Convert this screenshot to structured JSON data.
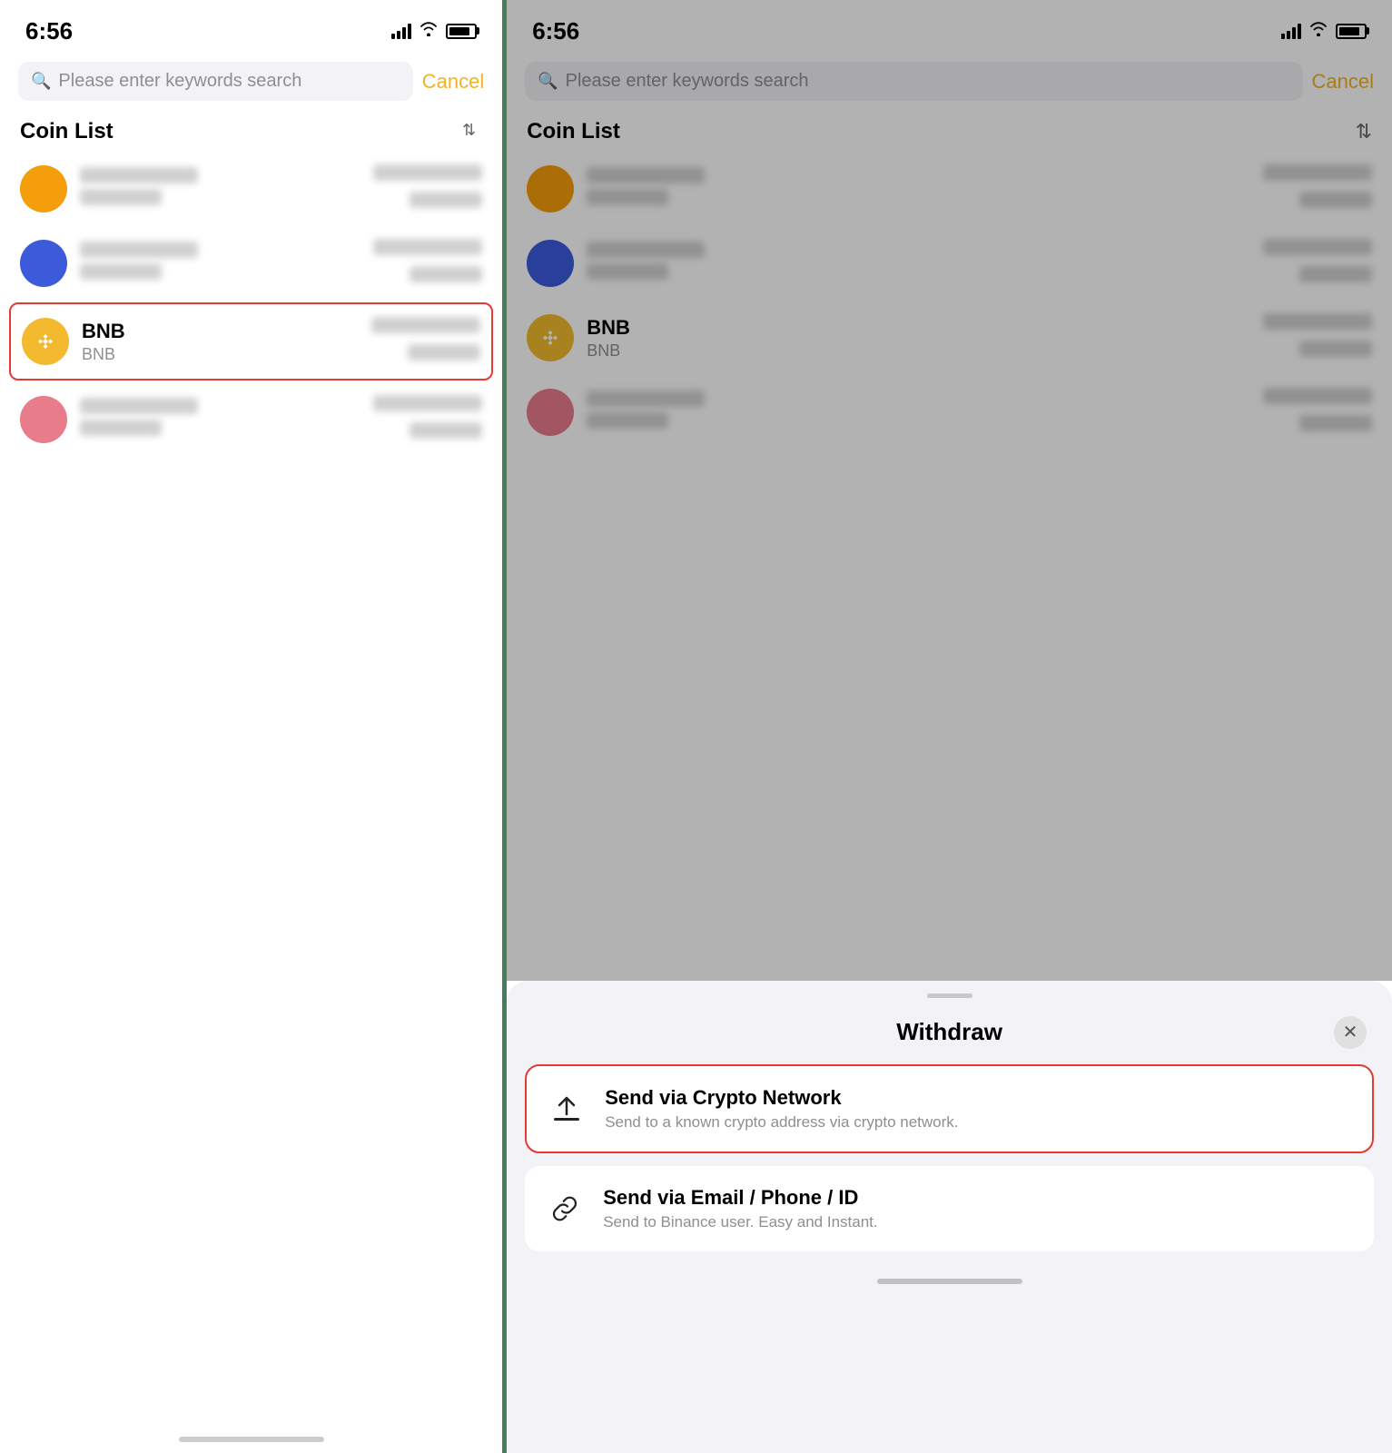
{
  "left": {
    "status": {
      "time": "6:56"
    },
    "search": {
      "placeholder": "Please enter keywords search",
      "cancel_label": "Cancel"
    },
    "coin_list": {
      "title": "Coin List",
      "sort_icon": "↕"
    },
    "coins": [
      {
        "id": "coin1",
        "color": "orange",
        "highlighted": false,
        "name": null,
        "symbol": null
      },
      {
        "id": "coin2",
        "color": "blue",
        "highlighted": false,
        "name": null,
        "symbol": null
      },
      {
        "id": "bnb",
        "color": "bnb",
        "highlighted": true,
        "name": "BNB",
        "symbol": "BNB"
      },
      {
        "id": "coin4",
        "color": "pink",
        "highlighted": false,
        "name": null,
        "symbol": null
      }
    ]
  },
  "right": {
    "status": {
      "time": "6:56"
    },
    "search": {
      "placeholder": "Please enter keywords search",
      "cancel_label": "Cancel"
    },
    "coin_list": {
      "title": "Coin List",
      "sort_icon": "↕"
    },
    "coins": [
      {
        "id": "coin1",
        "color": "orange",
        "highlighted": false,
        "name": null,
        "symbol": null
      },
      {
        "id": "coin2",
        "color": "blue",
        "highlighted": false,
        "name": null,
        "symbol": null
      },
      {
        "id": "bnb",
        "color": "bnb",
        "highlighted": false,
        "name": "BNB",
        "symbol": "BNB"
      },
      {
        "id": "coin4",
        "color": "pink",
        "highlighted": false,
        "name": null,
        "symbol": null
      }
    ],
    "withdraw_sheet": {
      "title": "Withdraw",
      "options": [
        {
          "id": "crypto",
          "title": "Send via Crypto Network",
          "description": "Send to a known crypto address via crypto network.",
          "highlighted": true
        },
        {
          "id": "email",
          "title": "Send via Email / Phone / ID",
          "description": "Send to Binance user. Easy and Instant.",
          "highlighted": false
        }
      ]
    }
  }
}
